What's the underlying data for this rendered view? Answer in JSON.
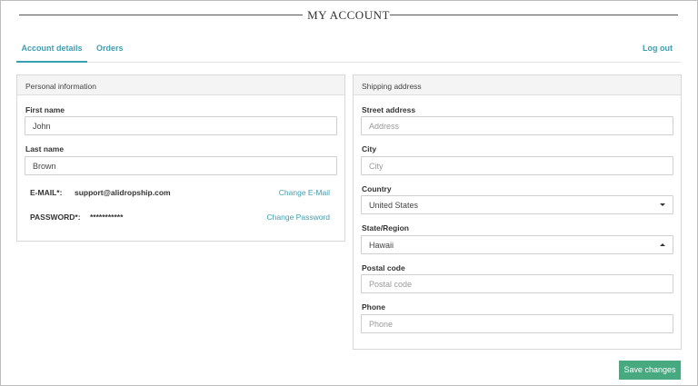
{
  "page": {
    "title": "MY ACCOUNT"
  },
  "tabs": [
    {
      "label": "Account details",
      "active": true
    },
    {
      "label": "Orders",
      "active": false
    }
  ],
  "logout_label": "Log out",
  "personal": {
    "heading": "Personal information",
    "first_name": {
      "label": "First name",
      "value": "John"
    },
    "last_name": {
      "label": "Last name",
      "value": "Brown"
    },
    "email": {
      "label": "E-MAIL*:",
      "value": "support@alidropship.com",
      "link": "Change E-Mail"
    },
    "password": {
      "label": "PASSWORD*:",
      "value": "***********",
      "link": "Change Password"
    }
  },
  "shipping": {
    "heading": "Shipping address",
    "street": {
      "label": "Street address",
      "placeholder": "Address"
    },
    "city": {
      "label": "City",
      "placeholder": "City"
    },
    "country": {
      "label": "Country",
      "value": "United States"
    },
    "state": {
      "label": "State/Region",
      "value": "Hawaii"
    },
    "postal": {
      "label": "Postal code",
      "placeholder": "Postal code"
    },
    "phone": {
      "label": "Phone",
      "placeholder": "Phone"
    }
  },
  "save_label": "Save changes",
  "colors": {
    "accent": "#3b9fb3",
    "save": "#47a97f"
  }
}
